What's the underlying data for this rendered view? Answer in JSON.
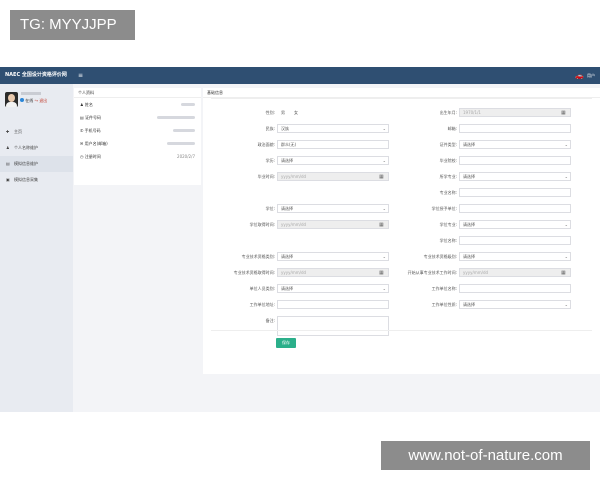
{
  "watermark": {
    "top": "TG: MYYJJPP",
    "bottom": "www.not-of-nature.com"
  },
  "topbar": {
    "brand": "NAEC 全国设计资格评价网",
    "menu_icon": "≡",
    "user_label": "用户"
  },
  "sidebar": {
    "status": "在线",
    "logout": "退出",
    "items": [
      {
        "label": "主页",
        "icon": "home-icon"
      },
      {
        "label": "个人名称维护",
        "icon": "user-icon"
      },
      {
        "label": "模拟信息维护",
        "icon": "edit-icon"
      },
      {
        "label": "模拟信息采集",
        "icon": "form-icon"
      }
    ]
  },
  "profile_card": {
    "title": "个人资料",
    "rows": [
      {
        "label": "姓名",
        "value": ""
      },
      {
        "label": "证件号码",
        "value": ""
      },
      {
        "label": "手机号码",
        "value": ""
      },
      {
        "label": "用户名(邮箱)",
        "value": ""
      },
      {
        "label": "注册时间",
        "value": "2020/2/7"
      }
    ]
  },
  "form": {
    "title": "基础信息",
    "gender": {
      "label": "性别:",
      "options": [
        "男",
        "女"
      ]
    },
    "birth": {
      "label": "出生年月:",
      "value": "1970/1/1"
    },
    "nation": {
      "label": "民族:",
      "value": "汉族"
    },
    "email": {
      "label": "邮箱:",
      "value": ""
    },
    "politics": {
      "label": "政治面貌:",
      "value": "群众(无)"
    },
    "doc_type": {
      "label": "证件类型:",
      "value": "请选择"
    },
    "education": {
      "label": "学历:",
      "value": "请选择"
    },
    "grad_school": {
      "label": "毕业院校:",
      "value": ""
    },
    "grad_time": {
      "label": "毕业时间:",
      "value": "yyyy/mm/dd"
    },
    "major": {
      "label": "所学专业:",
      "value": "请选择"
    },
    "major_name": {
      "label": "专业名称:",
      "value": ""
    },
    "degree": {
      "label": "学位:",
      "value": "请选择"
    },
    "degree_school": {
      "label": "学位授予单位:",
      "value": ""
    },
    "degree_time": {
      "label": "学位取得时间:",
      "value": "yyyy/mm/dd"
    },
    "degree_major": {
      "label": "学位专业:",
      "value": "请选择"
    },
    "degree_name": {
      "label": "学位名称:",
      "value": ""
    },
    "title_cat": {
      "label": "专业技术资格类别:",
      "value": "请选择"
    },
    "title_level": {
      "label": "专业技术资格级别:",
      "value": "请选择"
    },
    "title_time": {
      "label": "专业技术资格取得时间:",
      "value": "yyyy/mm/dd"
    },
    "work_start": {
      "label": "开始从事专业技术工作时间:",
      "value": "yyyy/mm/dd"
    },
    "work_kind": {
      "label": "单位人员类别:",
      "value": "请选择"
    },
    "work_name": {
      "label": "工作单位名称:",
      "value": ""
    },
    "work_addr": {
      "label": "工作单位地址:",
      "value": ""
    },
    "work_type": {
      "label": "工作单位性质:",
      "value": "请选择"
    },
    "remark": {
      "label": "备注:",
      "value": ""
    },
    "save": "保存"
  }
}
